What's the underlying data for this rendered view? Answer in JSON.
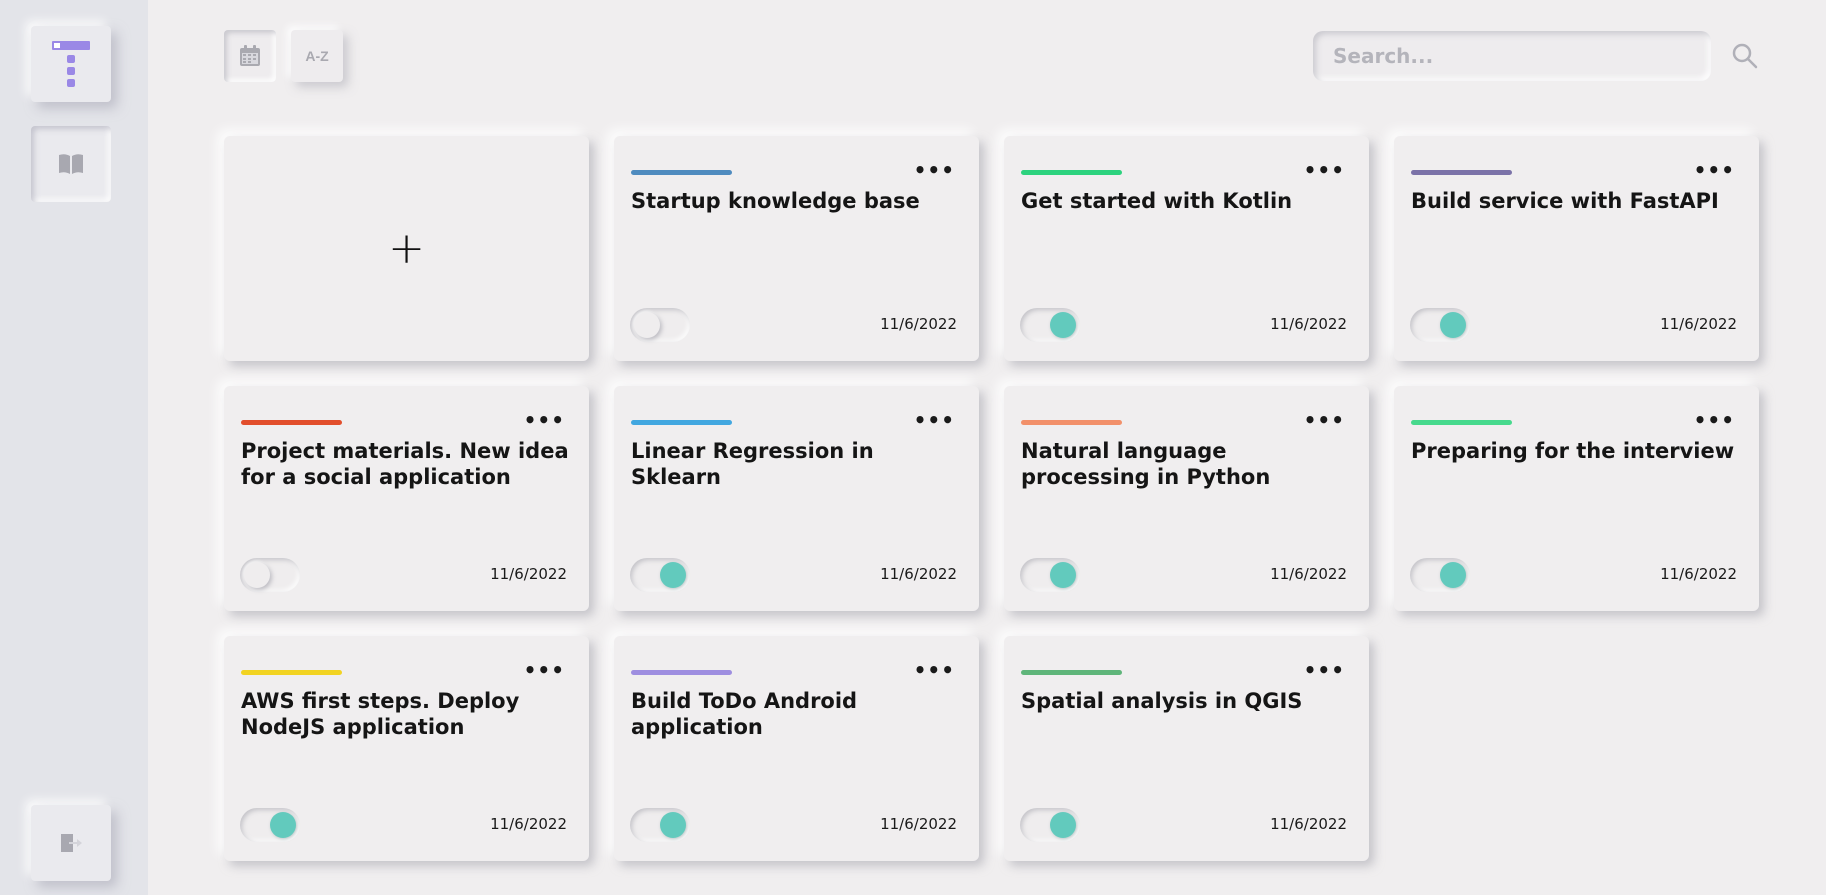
{
  "sidebar": {
    "logo_icon": "tasks-logo-icon",
    "nav_icon": "book-icon",
    "logout_icon": "logout-icon"
  },
  "toolbar": {
    "sort_date_icon": "calendar-icon",
    "sort_az_label": "A-Z",
    "search_placeholder": "Search...",
    "search_icon": "search-icon"
  },
  "add_card": {
    "label": "+"
  },
  "cards": [
    {
      "title": "Startup knowledge base",
      "color": "#4f8bbf",
      "enabled": false,
      "date": "11/6/2022"
    },
    {
      "title": "Get started with Kotlin",
      "color": "#2dd27e",
      "enabled": true,
      "date": "11/6/2022"
    },
    {
      "title": "Build service with FastAPI",
      "color": "#7b72a8",
      "enabled": true,
      "date": "11/6/2022"
    },
    {
      "title": "Project materials. New idea for a social application",
      "color": "#e24e2c",
      "enabled": false,
      "date": "11/6/2022"
    },
    {
      "title": "Linear Regression in Sklearn",
      "color": "#42a7e0",
      "enabled": true,
      "date": "11/6/2022"
    },
    {
      "title": "Natural language processing in Python",
      "color": "#f2906a",
      "enabled": true,
      "date": "11/6/2022"
    },
    {
      "title": "Preparing for the interview",
      "color": "#47d98d",
      "enabled": true,
      "date": "11/6/2022"
    },
    {
      "title": "AWS first steps. Deploy NodeJS application",
      "color": "#f2d322",
      "enabled": true,
      "date": "11/6/2022"
    },
    {
      "title": "Build ToDo Android application",
      "color": "#9e8ee0",
      "enabled": true,
      "date": "11/6/2022"
    },
    {
      "title": "Spatial analysis in QGIS",
      "color": "#5fb57a",
      "enabled": true,
      "date": "11/6/2022"
    }
  ],
  "colors": {
    "accent_toggle": "#62cabd",
    "logo_purple": "#9a88e6",
    "background": "#f0eeef",
    "sidebar_bg": "#e3e4e9"
  }
}
